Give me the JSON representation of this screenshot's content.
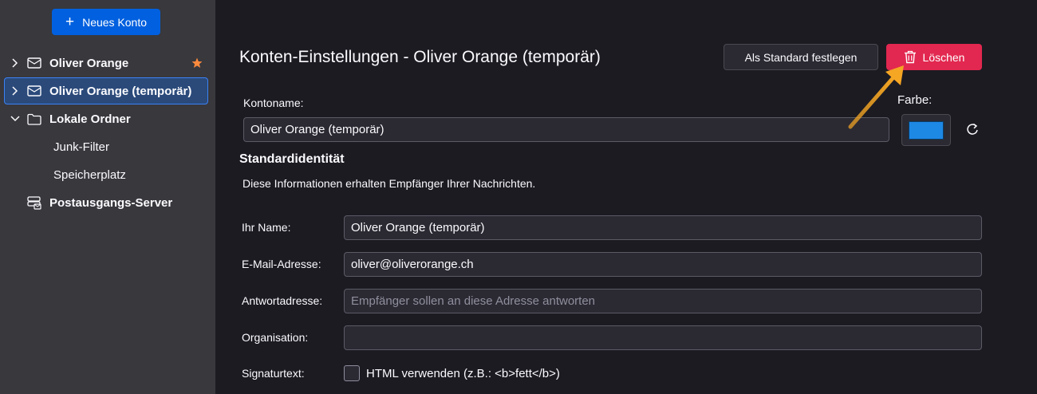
{
  "sidebar": {
    "new_account_label": "Neues Konto",
    "items": [
      {
        "label": "Oliver Orange",
        "favorite": true
      },
      {
        "label": "Oliver Orange (temporär)",
        "selected": true
      },
      {
        "label": "Lokale Ordner"
      },
      {
        "label": "Junk-Filter"
      },
      {
        "label": "Speicherplatz"
      },
      {
        "label": "Postausgangs-Server"
      }
    ]
  },
  "main": {
    "title": "Konten-Einstellungen - Oliver Orange (temporär)",
    "set_default_label": "Als Standard festlegen",
    "delete_label": "Löschen",
    "account_name_label": "Kontoname:",
    "account_name_value": "Oliver Orange (temporär)",
    "color_label": "Farbe:",
    "color_value": "#1e88e5",
    "identity_title": "Standardidentität",
    "identity_desc": "Diese Informationen erhalten Empfänger Ihrer Nachrichten.",
    "fields": {
      "name": {
        "label": "Ihr Name:",
        "value": "Oliver Orange (temporär)"
      },
      "email": {
        "label": "E-Mail-Adresse:",
        "value": "oliver@oliverorange.ch"
      },
      "reply": {
        "label": "Antwortadresse:",
        "placeholder": "Empfänger sollen an diese Adresse antworten"
      },
      "org": {
        "label": "Organisation:",
        "value": ""
      },
      "signature": {
        "label": "Signaturtext:",
        "html_checkbox_label": "HTML verwenden (z.B.: <b>fett</b>)"
      }
    }
  },
  "colors": {
    "accent": "#0060df",
    "danger": "#e22850",
    "favorite_star": "#ff8a3d",
    "annotation_arrow": "#f5a623"
  }
}
